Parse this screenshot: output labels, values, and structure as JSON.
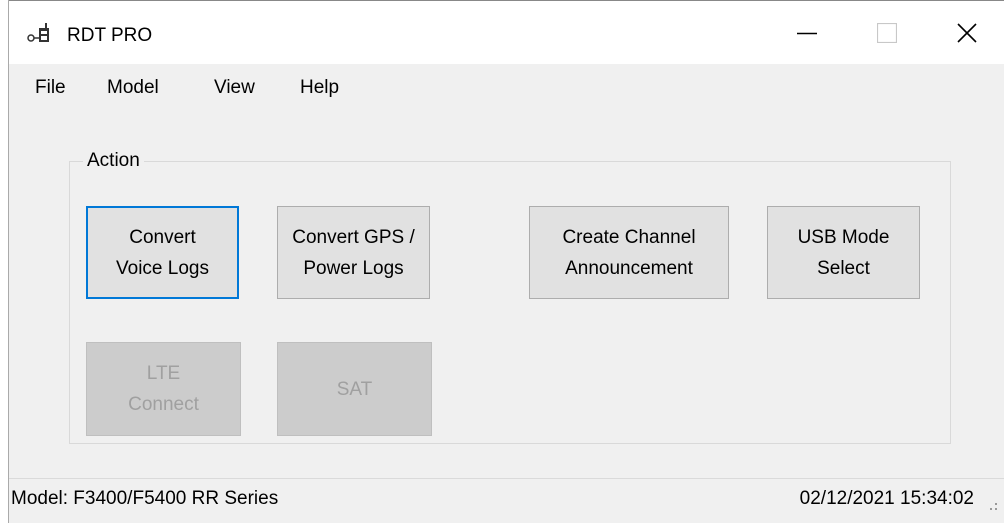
{
  "window": {
    "title": "RDT PRO",
    "icon": "app-radio-icon"
  },
  "title_buttons": {
    "minimize_icon": "minimize-icon",
    "maximize_icon": "maximize-icon",
    "close_icon": "close-icon"
  },
  "menu": {
    "items": [
      {
        "label": "File"
      },
      {
        "label": "Model"
      },
      {
        "label": "View"
      },
      {
        "label": "Help"
      }
    ]
  },
  "action_group": {
    "label": "Action",
    "buttons": [
      {
        "label": "Convert\nVoice Logs",
        "state": "focused"
      },
      {
        "label": "Convert GPS /\nPower Logs",
        "state": "enabled"
      },
      {
        "label": "Create Channel\nAnnouncement",
        "state": "enabled"
      },
      {
        "label": "USB Mode\nSelect",
        "state": "enabled"
      },
      {
        "label": "LTE\nConnect",
        "state": "disabled"
      },
      {
        "label": "SAT",
        "state": "disabled"
      }
    ]
  },
  "status": {
    "model": "Model: F3400/F5400 RR Series",
    "datetime": "02/12/2021  15:34:02"
  },
  "colors": {
    "window_bg": "#f0f0f0",
    "titlebar_bg": "#ffffff",
    "button_bg": "#e1e1e1",
    "button_border": "#adadad",
    "focus_border": "#0078d7",
    "disabled_bg": "#cccccc",
    "disabled_text": "#a0a0a0"
  }
}
